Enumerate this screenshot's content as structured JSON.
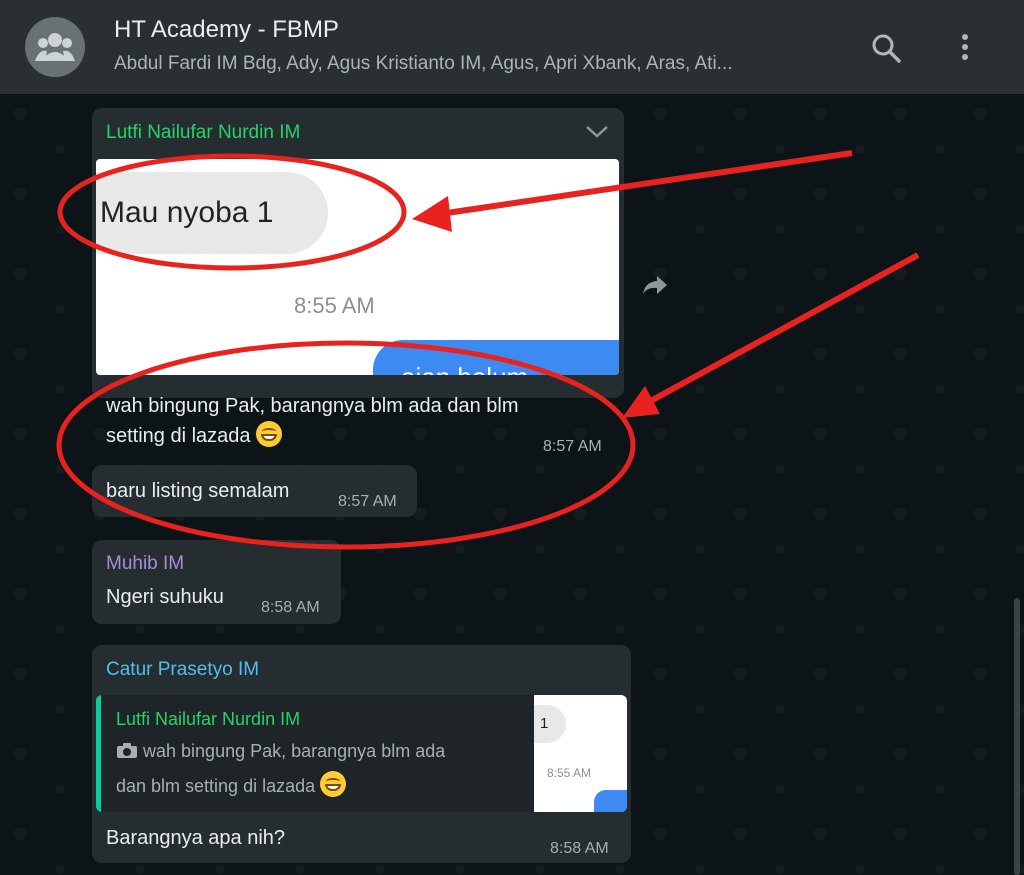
{
  "header": {
    "title": "HT Academy - FBMP",
    "subtitle": "Abdul Fardi IM Bdg, Ady, Agus Kristianto IM, Agus, Apri Xbank, Aras, Ati..."
  },
  "messages": {
    "m1": {
      "sender": "Lutfi Nailufar Nurdin IM",
      "sender_color": "#25d366",
      "image": {
        "bubble_text": "Mau nyoba 1",
        "time": "8:55 AM",
        "partial_text": "aian belum"
      }
    },
    "m2": {
      "text_line1": "wah bingung Pak, barangnya blm ada dan blm",
      "text_line2": "setting di lazada",
      "emoji": "grinning-face-emoji",
      "time": "8:57 AM"
    },
    "m3": {
      "text": "baru listing semalam",
      "time": "8:57 AM"
    },
    "m4": {
      "sender": "Muhib IM",
      "sender_color": "#a78bdb",
      "text": "Ngeri suhuku",
      "time": "8:58 AM"
    },
    "m5": {
      "sender": "Catur Prasetyo IM",
      "sender_color": "#53bdeb",
      "quote": {
        "sender": "Lutfi Nailufar Nurdin IM",
        "line1": "wah bingung Pak, barangnya blm ada",
        "line2": "dan blm setting di lazada",
        "thumb_text": "1",
        "thumb_time": "8:55 AM"
      },
      "text": "Barangnya apa nih?",
      "time": "8:58 AM"
    }
  },
  "annotations": {
    "color": "#e8231f"
  }
}
